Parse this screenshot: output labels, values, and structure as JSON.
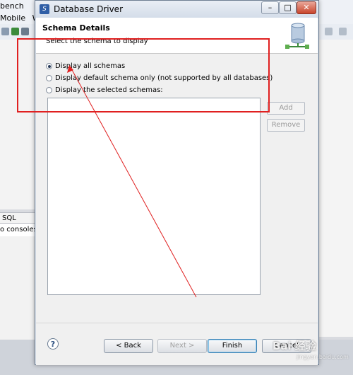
{
  "background_app": {
    "title_fragment": "bench",
    "menu_items": [
      "Mobile",
      "W"
    ],
    "views_tab_label": "SQL Result",
    "views_body_text": "o consoles t"
  },
  "dialog": {
    "title": "Database Driver",
    "window_buttons": {
      "minimize": "–",
      "maximize": "□",
      "close": "✕"
    },
    "header": {
      "title": "Schema Details",
      "description": "Select the schema to display"
    },
    "options": [
      {
        "label": "Display all schemas",
        "selected": true
      },
      {
        "label": "Display default schema only (not supported by all databases)",
        "selected": false
      },
      {
        "label": "Display the selected schemas:",
        "selected": false
      }
    ],
    "side_buttons": {
      "add": "Add",
      "remove": "Remove"
    },
    "footer": {
      "help": "?",
      "back": "< Back",
      "next": "Next >",
      "finish": "Finish",
      "cancel": "Cancel"
    }
  },
  "watermark": {
    "text": "Bai 经验",
    "sub": "jingyan.baidu.com"
  },
  "colors": {
    "annotation": "#e02020",
    "accent": "#3c7fb1"
  }
}
